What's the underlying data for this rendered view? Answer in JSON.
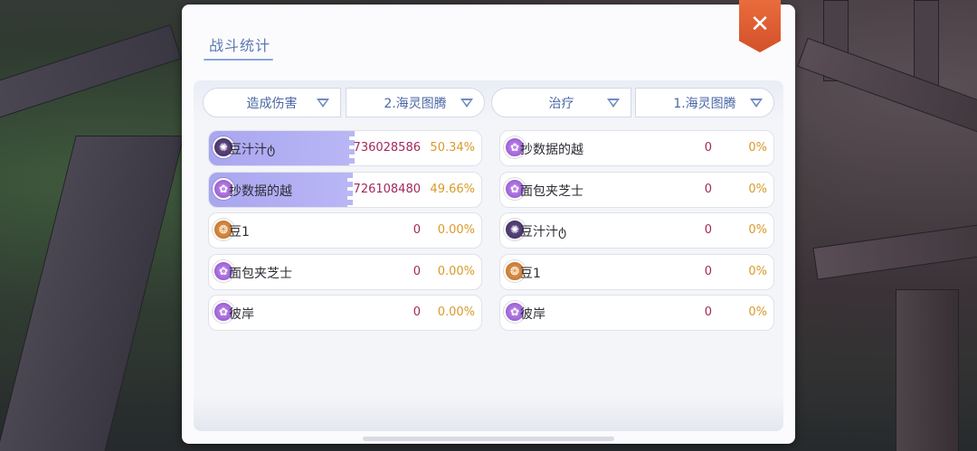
{
  "window": {
    "title": "战斗统计",
    "close_label": "✕"
  },
  "filters": {
    "left_type": "造成伤害",
    "left_round": "2.海灵图腾",
    "right_type": "治疗",
    "right_round": "1.海灵图腾"
  },
  "left_rows": [
    {
      "name": "豆汁汁ტ",
      "value": "736028586",
      "percent": "50.34%",
      "share": 0.5034,
      "icon": "dark-emblem-icon"
    },
    {
      "name": "抄数据的越",
      "value": "726108480",
      "percent": "49.66%",
      "share": 0.4966,
      "icon": "purple-emblem-icon"
    },
    {
      "name": "豆1",
      "value": "0",
      "percent": "0.00%",
      "share": 0,
      "icon": "orange-emblem-icon"
    },
    {
      "name": "面包夹芝士",
      "value": "0",
      "percent": "0.00%",
      "share": 0,
      "icon": "purple-emblem-icon"
    },
    {
      "name": "彼岸",
      "value": "0",
      "percent": "0.00%",
      "share": 0,
      "icon": "purple-emblem-icon"
    }
  ],
  "right_rows": [
    {
      "name": "抄数据的越",
      "value": "0",
      "percent": "0%",
      "icon": "purple-emblem-icon"
    },
    {
      "name": "面包夹芝士",
      "value": "0",
      "percent": "0%",
      "icon": "purple-emblem-icon"
    },
    {
      "name": "豆汁汁ტ",
      "value": "0",
      "percent": "0%",
      "icon": "dark-emblem-icon"
    },
    {
      "name": "豆1",
      "value": "0",
      "percent": "0%",
      "icon": "orange-emblem-icon"
    },
    {
      "name": "彼岸",
      "value": "0",
      "percent": "0%",
      "icon": "purple-emblem-icon"
    }
  ],
  "colors": {
    "accent": "#5c79b3",
    "close": "#d4502a",
    "bar_fill": "#b8b6f5",
    "value": "#a3285a",
    "percent": "#d99a2a"
  }
}
